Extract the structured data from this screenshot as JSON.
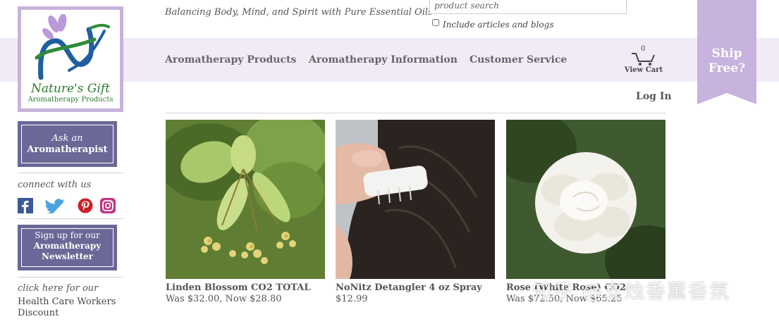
{
  "brand": {
    "name": "Nature's Gift",
    "subtitle": "Aromatherapy Products",
    "accent_color": "#c7b3dd",
    "nav_band_color": "#f1ebf8",
    "button_color": "#6b6897"
  },
  "header": {
    "tagline": "Balancing Body, Mind, and Spirit with Pure Essential Oils",
    "search": {
      "placeholder": "product search",
      "value": "",
      "include_label": "Include articles and blogs",
      "include_checked": false
    }
  },
  "nav": {
    "items": [
      {
        "label": "Aromatherapy Products"
      },
      {
        "label": "Aromatherapy Information"
      },
      {
        "label": "Customer Service"
      }
    ],
    "cart": {
      "count": "0",
      "label": "View Cart",
      "icon": "cart-icon"
    },
    "ship_free": {
      "line1": "Ship",
      "line2": "Free?"
    },
    "login": "Log In"
  },
  "sidebar": {
    "ask": {
      "line1": "Ask an",
      "line2": "Aromatherapist"
    },
    "connect_label": "connect with us",
    "social": [
      {
        "name": "facebook-icon",
        "color": "#3b5998"
      },
      {
        "name": "twitter-icon",
        "color": "#4aa3df"
      },
      {
        "name": "pinterest-icon",
        "color": "#cb2027"
      },
      {
        "name": "instagram-icon",
        "color": "#c13584"
      }
    ],
    "newsletter": {
      "line1": "Sign up for our",
      "line2": "Aromatherapy",
      "line3": "Newsletter"
    },
    "click_here": "click here for our",
    "health_care": "Health Care Workers Discount"
  },
  "products": [
    {
      "name": "Linden Blossom CO2 TOTAL",
      "price": "Was $32.00, Now $28.80",
      "image": "linden-blossom"
    },
    {
      "name": "NoNitz Detangler 4 oz Spray",
      "price": "$12.99",
      "image": "nonitz-detangler"
    },
    {
      "name": "Rose (White Rose) CO2",
      "price": "Was $72.50, Now $65.25",
      "image": "white-rose"
    }
  ],
  "watermark": "知乎 @支烛香薰香氛"
}
